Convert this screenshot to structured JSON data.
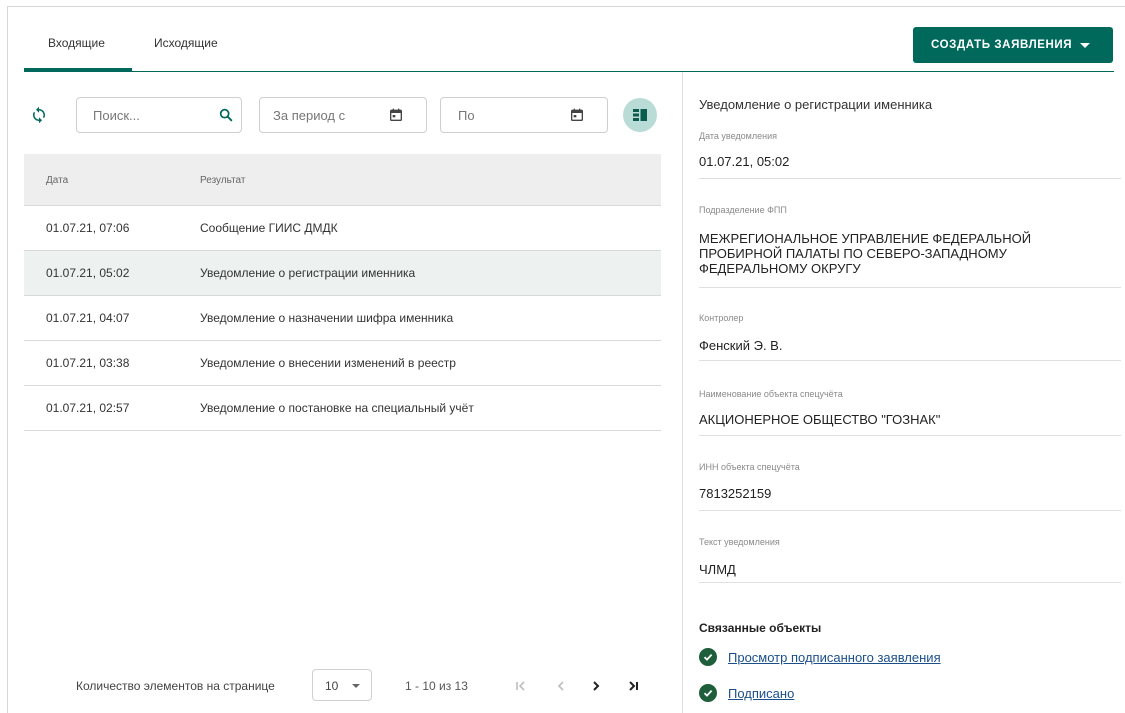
{
  "tabs": [
    {
      "label": "Входящие",
      "active": true
    },
    {
      "label": "Исходящие",
      "active": false
    }
  ],
  "create_button": {
    "label": "СОЗДАТЬ ЗАЯВЛЕНИЯ"
  },
  "toolbar": {
    "search_placeholder": "Поиск...",
    "period_from_placeholder": "За период с",
    "period_to_placeholder": "По"
  },
  "table": {
    "columns": [
      "Дата",
      "Результат"
    ],
    "rows": [
      {
        "date": "01.07.21, 07:06",
        "result": "Сообщение ГИИС ДМДК",
        "selected": false
      },
      {
        "date": "01.07.21, 05:02",
        "result": "Уведомление о регистрации именника",
        "selected": true
      },
      {
        "date": "01.07.21, 04:07",
        "result": "Уведомление о назначении шифра именника",
        "selected": false
      },
      {
        "date": "01.07.21, 03:38",
        "result": "Уведомление о внесении изменений в реестр",
        "selected": false
      },
      {
        "date": "01.07.21, 02:57",
        "result": "Уведомление о постановке на специальный учёт",
        "selected": false
      }
    ]
  },
  "paginator": {
    "label": "Количество элементов на странице",
    "page_size": "10",
    "range": "1 - 10 из 13"
  },
  "details": {
    "title": "Уведомление о регистрации именника",
    "fields": [
      {
        "label": "Дата уведомления",
        "value": "01.07.21, 05:02"
      },
      {
        "label": "Подразделение ФПП",
        "value": "МЕЖРЕГИОНАЛЬНОЕ УПРАВЛЕНИЕ ФЕДЕРАЛЬНОЙ ПРОБИРНОЙ ПАЛАТЫ ПО СЕВЕРО-ЗАПАДНОМУ ФЕДЕРАЛЬНОМУ ОКРУГУ"
      },
      {
        "label": "Контролер",
        "value": "Фенский Э. В."
      },
      {
        "label": "Наименование объекта спецучёта",
        "value": "АКЦИОНЕРНОЕ ОБЩЕСТВО \"ГОЗНАК\""
      },
      {
        "label": "ИНН объекта спецучёта",
        "value": "7813252159"
      },
      {
        "label": "Текст уведомления",
        "value": "ЧЛМД"
      }
    ],
    "related_title": "Связанные объекты",
    "related": [
      {
        "label": "Просмотр подписанного заявления"
      },
      {
        "label": "Подписано"
      }
    ]
  },
  "colors": {
    "accent": "#00695c",
    "selected_row": "#edf2f1",
    "check": "#1e5e3a",
    "link": "#1b4f8a"
  }
}
